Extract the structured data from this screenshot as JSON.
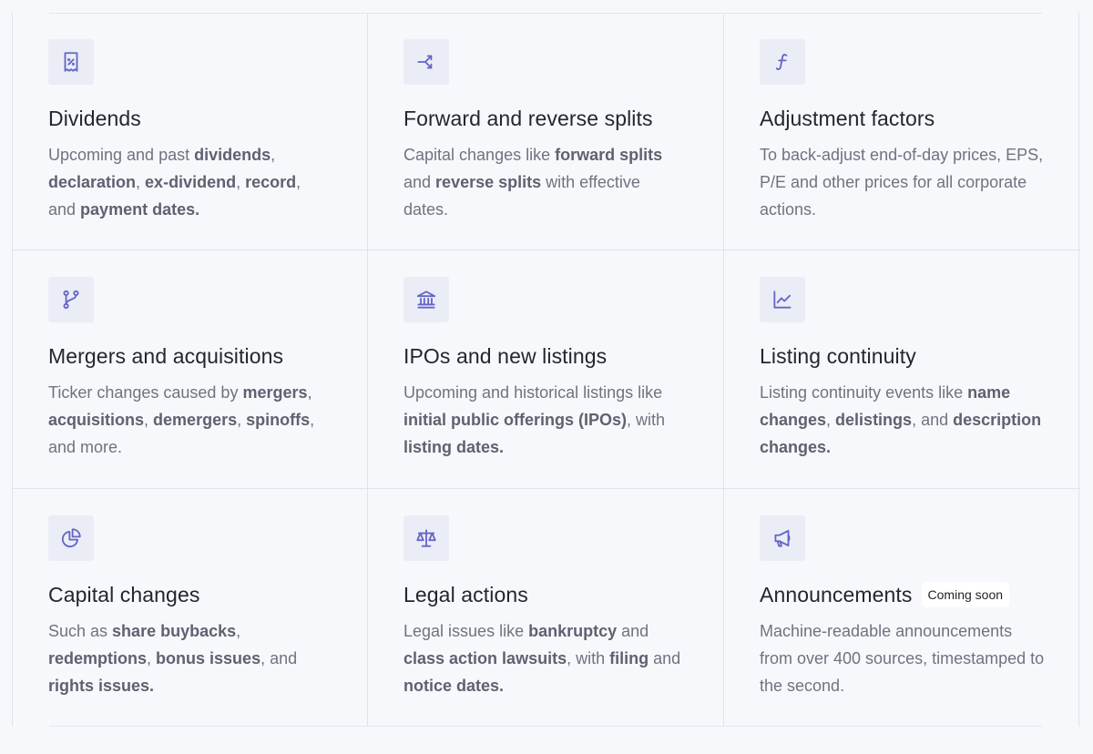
{
  "features": [
    {
      "icon": "receipt-percent-icon",
      "title": "Dividends",
      "parts": [
        {
          "t": "Upcoming and past "
        },
        {
          "t": "dividends",
          "b": true
        },
        {
          "t": ", "
        },
        {
          "t": "declaration",
          "b": true
        },
        {
          "t": ", "
        },
        {
          "t": "ex-dividend",
          "b": true
        },
        {
          "t": ", "
        },
        {
          "t": "record",
          "b": true
        },
        {
          "t": ", and "
        },
        {
          "t": "payment dates.",
          "b": true
        }
      ]
    },
    {
      "icon": "split-arrows-icon",
      "title": "Forward and reverse splits",
      "parts": [
        {
          "t": "Capital changes like "
        },
        {
          "t": "forward splits",
          "b": true
        },
        {
          "t": " and "
        },
        {
          "t": "reverse splits",
          "b": true
        },
        {
          "t": " with effective dates."
        }
      ]
    },
    {
      "icon": "function-icon",
      "title": "Adjustment factors",
      "parts": [
        {
          "t": "To back-adjust end-of-day prices, EPS, P/E and other prices for all corporate actions."
        }
      ]
    },
    {
      "icon": "merge-branch-icon",
      "title": "Mergers and acquisitions",
      "parts": [
        {
          "t": "Ticker changes caused by "
        },
        {
          "t": "mergers",
          "b": true
        },
        {
          "t": ", "
        },
        {
          "t": "acquisitions",
          "b": true
        },
        {
          "t": ", "
        },
        {
          "t": "demergers",
          "b": true
        },
        {
          "t": ", "
        },
        {
          "t": "spinoffs",
          "b": true
        },
        {
          "t": ", and more."
        }
      ]
    },
    {
      "icon": "bank-building-icon",
      "title": "IPOs and new listings",
      "parts": [
        {
          "t": "Upcoming and historical listings like "
        },
        {
          "t": "initial public offerings (IPOs)",
          "b": true
        },
        {
          "t": ", with "
        },
        {
          "t": "listing dates.",
          "b": true
        }
      ]
    },
    {
      "icon": "line-chart-icon",
      "title": "Listing continuity",
      "parts": [
        {
          "t": "Listing continuity events like "
        },
        {
          "t": "name changes",
          "b": true
        },
        {
          "t": ", "
        },
        {
          "t": "delistings",
          "b": true
        },
        {
          "t": ", and "
        },
        {
          "t": "description changes.",
          "b": true
        }
      ]
    },
    {
      "icon": "pie-chart-icon",
      "title": "Capital changes",
      "parts": [
        {
          "t": "Such as "
        },
        {
          "t": "share buybacks",
          "b": true
        },
        {
          "t": ", "
        },
        {
          "t": "redemptions",
          "b": true
        },
        {
          "t": ", "
        },
        {
          "t": "bonus issues",
          "b": true
        },
        {
          "t": ", and "
        },
        {
          "t": "rights issues.",
          "b": true
        }
      ]
    },
    {
      "icon": "scale-icon",
      "title": "Legal actions",
      "parts": [
        {
          "t": "Legal issues like "
        },
        {
          "t": "bankruptcy",
          "b": true
        },
        {
          "t": " and "
        },
        {
          "t": "class action lawsuits",
          "b": true
        },
        {
          "t": ", with "
        },
        {
          "t": "filing",
          "b": true
        },
        {
          "t": " and "
        },
        {
          "t": "notice dates.",
          "b": true
        }
      ]
    },
    {
      "icon": "megaphone-icon",
      "title": "Announcements",
      "badge": "Coming soon",
      "parts": [
        {
          "t": "Machine-readable announcements from over 400 sources, timestamped to the second."
        }
      ]
    }
  ],
  "colors": {
    "accent": "#6466c8",
    "icon_bg": "#ebedf6",
    "title": "#23262f",
    "body": "#6f7380",
    "bold": "#5e6270",
    "page_bg": "#f7f8fb",
    "border": "#e1e3e9"
  }
}
